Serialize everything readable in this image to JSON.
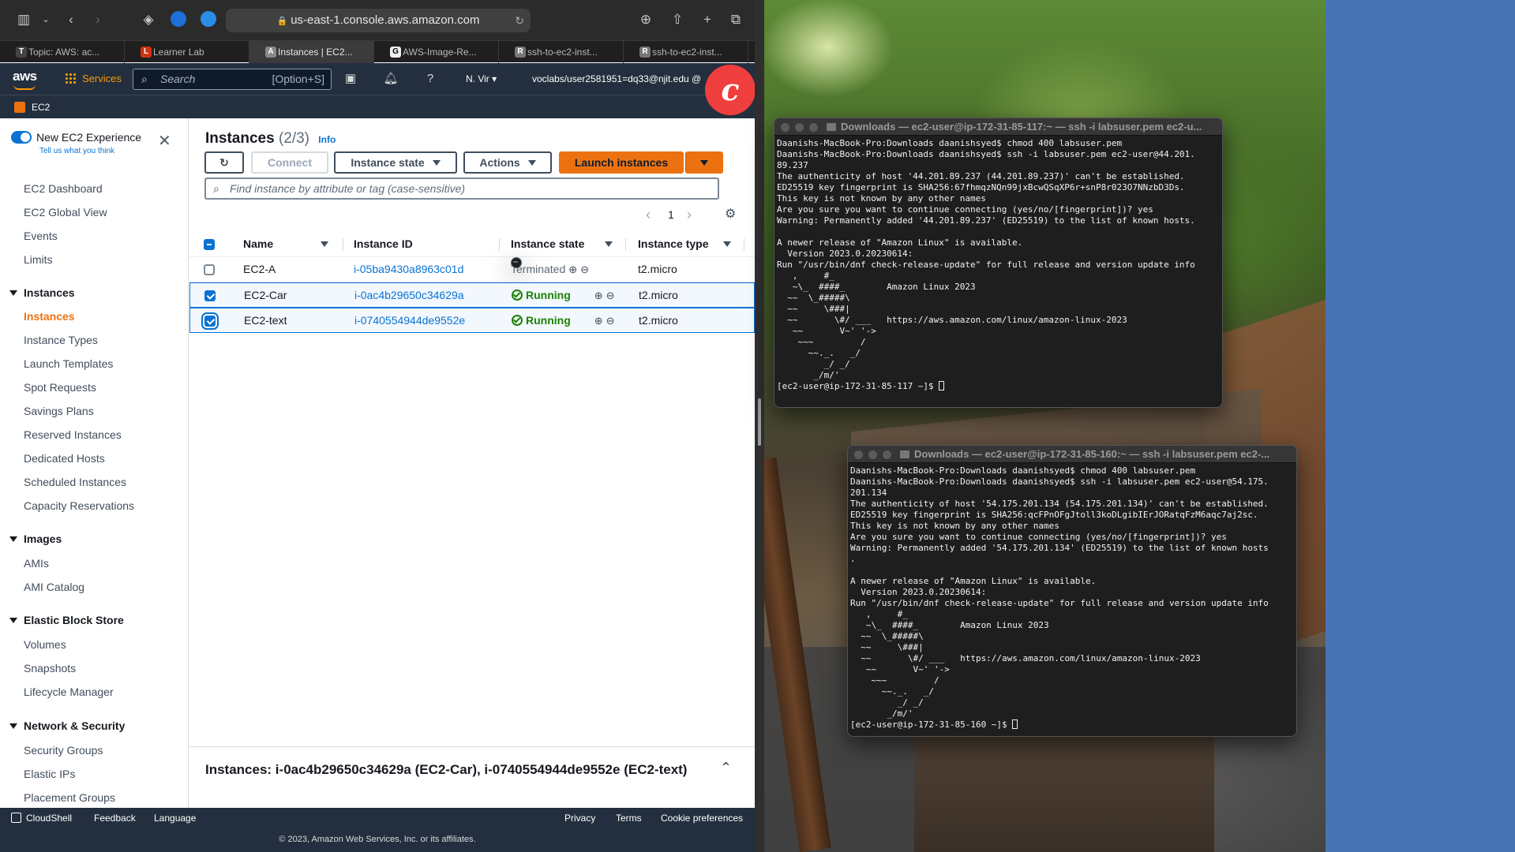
{
  "browser": {
    "url": "us-east-1.console.aws.amazon.com",
    "tabs": [
      {
        "label": "Topic: AWS: ac...",
        "favicon": "T"
      },
      {
        "label": "Learner Lab",
        "favicon": "L"
      },
      {
        "label": "Instances | EC2...",
        "favicon": "A"
      },
      {
        "label": "AWS-Image-Re...",
        "favicon": "G"
      },
      {
        "label": "ssh-to-ec2-inst...",
        "favicon": "R"
      },
      {
        "label": "ssh-to-ec2-inst...",
        "favicon": "R"
      }
    ]
  },
  "aws_nav": {
    "logo": "aws",
    "services": "Services",
    "search_placeholder": "Search",
    "search_shortcut": "[Option+S]",
    "region": "N. Vir",
    "account": "voclabs/user2581951=dq33@njit.edu @",
    "service_name": "EC2"
  },
  "sidenav": {
    "new_experience": "New EC2 Experience",
    "tell_us": "Tell us what you think",
    "top_items": [
      "EC2 Dashboard",
      "EC2 Global View",
      "Events",
      "Limits"
    ],
    "sections": [
      {
        "title": "Instances",
        "items": [
          "Instances",
          "Instance Types",
          "Launch Templates",
          "Spot Requests",
          "Savings Plans",
          "Reserved Instances",
          "Dedicated Hosts",
          "Scheduled Instances",
          "Capacity Reservations"
        ]
      },
      {
        "title": "Images",
        "items": [
          "AMIs",
          "AMI Catalog"
        ]
      },
      {
        "title": "Elastic Block Store",
        "items": [
          "Volumes",
          "Snapshots",
          "Lifecycle Manager"
        ]
      },
      {
        "title": "Network & Security",
        "items": [
          "Security Groups",
          "Elastic IPs",
          "Placement Groups"
        ]
      }
    ],
    "active_item": "Instances"
  },
  "main": {
    "title": "Instances",
    "count": "(2/3)",
    "info": "Info",
    "buttons": {
      "connect": "Connect",
      "instance_state": "Instance state",
      "actions": "Actions",
      "launch": "Launch instances"
    },
    "filter_placeholder": "Find instance by attribute or tag (case-sensitive)",
    "page": "1",
    "columns": [
      "Name",
      "Instance ID",
      "Instance state",
      "Instance type"
    ],
    "rows": [
      {
        "name": "EC2-A",
        "id": "i-05ba9430a8963c01d",
        "state": "Terminated",
        "type": "t2.micro",
        "selected": false
      },
      {
        "name": "EC2-Car",
        "id": "i-0ac4b29650c34629a",
        "state": "Running",
        "type": "t2.micro",
        "selected": true
      },
      {
        "name": "EC2-text",
        "id": "i-0740554944de9552e",
        "state": "Running",
        "type": "t2.micro",
        "selected": true
      }
    ],
    "detail_title": "Instances: i-0ac4b29650c34629a (EC2-Car), i-0740554944de9552e (EC2-text)"
  },
  "footer": {
    "cloudshell": "CloudShell",
    "feedback": "Feedback",
    "language": "Language",
    "privacy": "Privacy",
    "terms": "Terms",
    "cookie": "Cookie preferences",
    "copyright": "© 2023, Amazon Web Services, Inc. or its affiliates."
  },
  "terminal1": {
    "title": "Downloads — ec2-user@ip-172-31-85-117:~ — ssh -i labsuser.pem ec2-u...",
    "lines": [
      "Daanishs-MacBook-Pro:Downloads daanishsyed$ chmod 400 labsuser.pem",
      "Daanishs-MacBook-Pro:Downloads daanishsyed$ ssh -i labsuser.pem ec2-user@44.201.",
      "89.237",
      "The authenticity of host '44.201.89.237 (44.201.89.237)' can't be established.",
      "ED25519 key fingerprint is SHA256:67fhmqzNQn99jxBcwQSqXP6r+snP8r023O7NNzbD3Ds.",
      "This key is not known by any other names",
      "Are you sure you want to continue connecting (yes/no/[fingerprint])? yes",
      "Warning: Permanently added '44.201.89.237' (ED25519) to the list of known hosts.",
      "",
      "A newer release of \"Amazon Linux\" is available.",
      "  Version 2023.0.20230614:",
      "Run \"/usr/bin/dnf check-release-update\" for full release and version update info",
      "   ,     #_",
      "   ~\\_  ####_        Amazon Linux 2023",
      "  ~~  \\_#####\\",
      "  ~~     \\###|",
      "  ~~       \\#/ ___   https://aws.amazon.com/linux/amazon-linux-2023",
      "   ~~       V~' '->",
      "    ~~~         /",
      "      ~~._.   _/",
      "         _/ _/",
      "       _/m/'",
      "[ec2-user@ip-172-31-85-117 ~]$ "
    ]
  },
  "terminal2": {
    "title": "Downloads — ec2-user@ip-172-31-85-160:~ — ssh -i labsuser.pem ec2-...",
    "lines": [
      "Daanishs-MacBook-Pro:Downloads daanishsyed$ chmod 400 labsuser.pem",
      "Daanishs-MacBook-Pro:Downloads daanishsyed$ ssh -i labsuser.pem ec2-user@54.175.",
      "201.134",
      "The authenticity of host '54.175.201.134 (54.175.201.134)' can't be established.",
      "ED25519 key fingerprint is SHA256:qcFPnOFgJtoll3koDLgibIErJORatqFzM6aqc7aj2sc.",
      "This key is not known by any other names",
      "Are you sure you want to continue connecting (yes/no/[fingerprint])? yes",
      "Warning: Permanently added '54.175.201.134' (ED25519) to the list of known hosts",
      ".",
      "",
      "A newer release of \"Amazon Linux\" is available.",
      "  Version 2023.0.20230614:",
      "Run \"/usr/bin/dnf check-release-update\" for full release and version update info",
      "   ,     #_",
      "   ~\\_  ####_        Amazon Linux 2023",
      "  ~~  \\_#####\\",
      "  ~~     \\###|",
      "  ~~       \\#/ ___   https://aws.amazon.com/linux/amazon-linux-2023",
      "   ~~       V~' '->",
      "    ~~~         /",
      "      ~~._.   _/",
      "         _/ _/",
      "       _/m/'",
      "[ec2-user@ip-172-31-85-160 ~]$ "
    ]
  },
  "colors": {
    "aws_orange": "#ff9900",
    "aws_navy": "#232f3e",
    "link_blue": "#0972d3",
    "running_green": "#1d8102",
    "launch_orange": "#ec7211"
  }
}
